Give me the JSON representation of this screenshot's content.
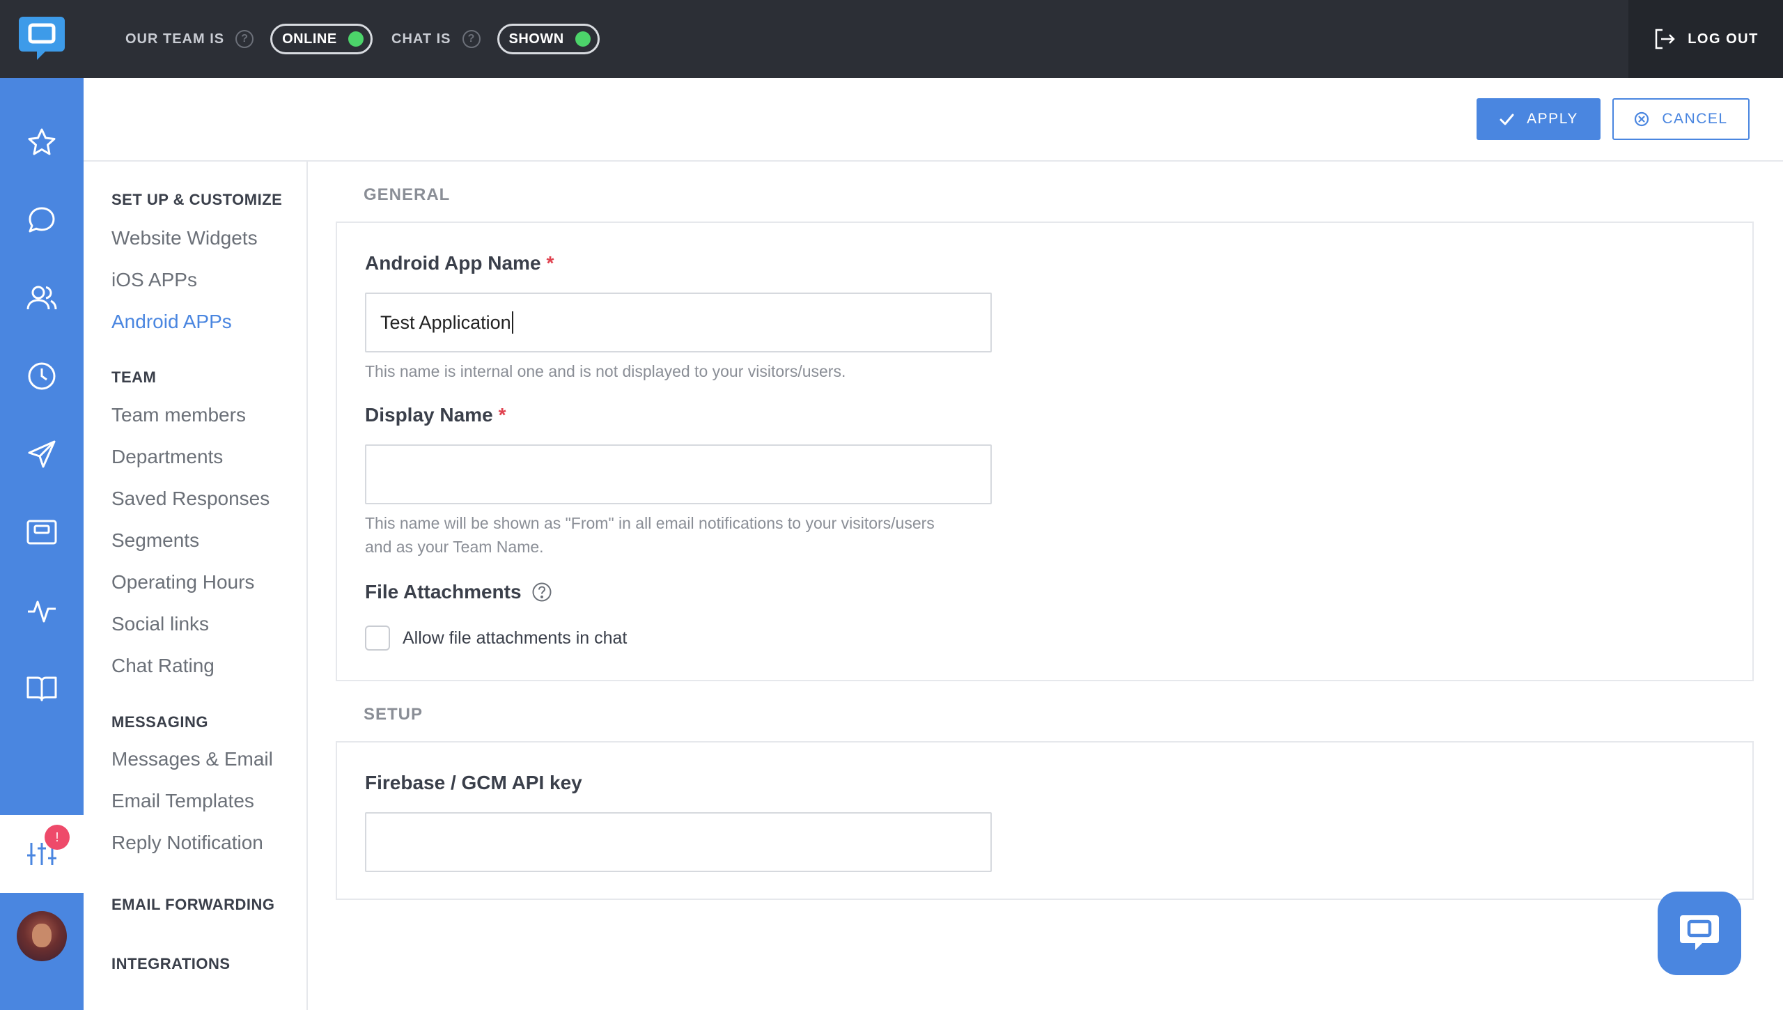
{
  "topbar": {
    "team_label": "OUR TEAM IS",
    "team_status": "ONLINE",
    "chat_label": "CHAT IS",
    "chat_status": "SHOWN",
    "logout_label": "LOG OUT",
    "status_color": "#4cd46a"
  },
  "rail": {
    "icons": [
      "star-icon",
      "chat-bubble-icon",
      "users-icon",
      "clock-icon",
      "send-icon",
      "widget-icon",
      "activity-icon",
      "book-icon",
      "settings-sliders-icon"
    ],
    "badge": "!",
    "accent_color": "#4a86e0"
  },
  "actions": {
    "apply_label": "APPLY",
    "cancel_label": "CANCEL"
  },
  "menu": {
    "setup_heading": "SET UP & CUSTOMIZE",
    "setup_items": [
      "Website Widgets",
      "iOS APPs",
      "Android APPs"
    ],
    "active_item": "Android APPs",
    "team_heading": "TEAM",
    "team_items": [
      "Team members",
      "Departments",
      "Saved Responses",
      "Segments",
      "Operating Hours",
      "Social links",
      "Chat Rating"
    ],
    "messaging_heading": "MESSAGING",
    "messaging_items": [
      "Messages & Email",
      "Email Templates",
      "Reply Notification"
    ],
    "email_forwarding_heading": "EMAIL FORWARDING",
    "integrations_heading": "INTEGRATIONS"
  },
  "general": {
    "title": "GENERAL",
    "app_name_label": "Android App Name",
    "required_mark": "*",
    "app_name_value": "Test Application",
    "app_name_hint": "This name is internal one and is not displayed to your visitors/users.",
    "display_name_label": "Display Name",
    "display_name_value": "",
    "display_name_hint": "This name will be shown as \"From\" in all email notifications to your visitors/users and as your Team Name.",
    "file_attachments_label": "File Attachments",
    "allow_attachments_label": "Allow file attachments in chat",
    "allow_attachments_checked": false
  },
  "setup": {
    "title": "SETUP",
    "api_key_label": "Firebase / GCM API key",
    "api_key_value": ""
  }
}
